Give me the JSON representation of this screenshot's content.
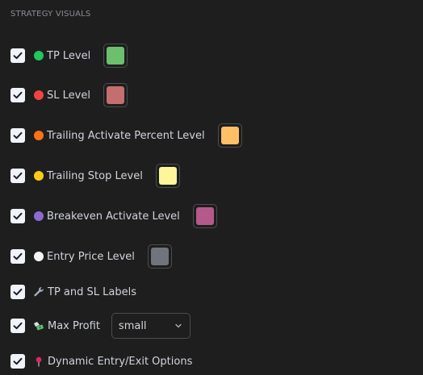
{
  "section": {
    "title": "STRATEGY VISUALS"
  },
  "items": [
    {
      "label": "TP Level",
      "checked": true,
      "icon": "green-circle",
      "icon_color": "#22c55e",
      "swatch": "#6cc06b"
    },
    {
      "label": "SL Level",
      "checked": true,
      "icon": "red-circle",
      "icon_color": "#ef4444",
      "swatch": "#c46f6f"
    },
    {
      "label": "Trailing Activate Percent Level",
      "checked": true,
      "icon": "orange-circle",
      "icon_color": "#f97316",
      "swatch": "#ffbf66"
    },
    {
      "label": "Trailing Stop Level",
      "checked": true,
      "icon": "yellow-circle",
      "icon_color": "#facc15",
      "swatch": "#fff59a"
    },
    {
      "label": "Breakeven Activate Level",
      "checked": true,
      "icon": "purple-circle",
      "icon_color": "#8b6bd1",
      "swatch": "#b5598a"
    },
    {
      "label": "Entry Price Level",
      "checked": true,
      "icon": "white-circle",
      "icon_color": "#f5f5f5",
      "swatch": "#72747d"
    },
    {
      "label": "TP and SL Labels",
      "checked": true,
      "icon": "wrench-icon"
    },
    {
      "label": "Max Profit",
      "checked": true,
      "icon": "money-with-wings-icon",
      "select_value": "small"
    },
    {
      "label": "Dynamic Entry/Exit Options",
      "checked": true,
      "icon": "pushpin-icon"
    }
  ]
}
